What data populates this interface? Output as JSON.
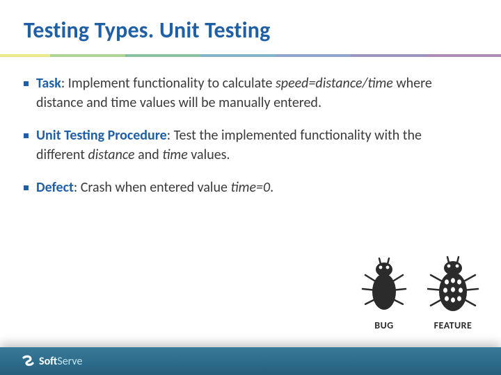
{
  "title": "Testing Types. Unit Testing",
  "bullets": [
    {
      "lead": "Task",
      "text_before": ": Implement functionality to calculate ",
      "ital1": "speed=distance/time",
      "text_mid": " where distance and time values will be manually entered.",
      "ital2": "",
      "text_after": ""
    },
    {
      "lead": "Unit Testing Procedure",
      "text_before": ": Test the implemented functionality with the different ",
      "ital1": "distance",
      "text_mid": " and ",
      "ital2": "time",
      "text_after": " values."
    },
    {
      "lead": "Defect",
      "text_before": ": Crash when entered value ",
      "ital1": "time=0",
      "text_mid": ".",
      "ital2": "",
      "text_after": ""
    }
  ],
  "figure": {
    "bug_label": "BUG",
    "feature_label": "FEATURE"
  },
  "footer": {
    "brand_a": "Soft",
    "brand_b": "Serve"
  }
}
